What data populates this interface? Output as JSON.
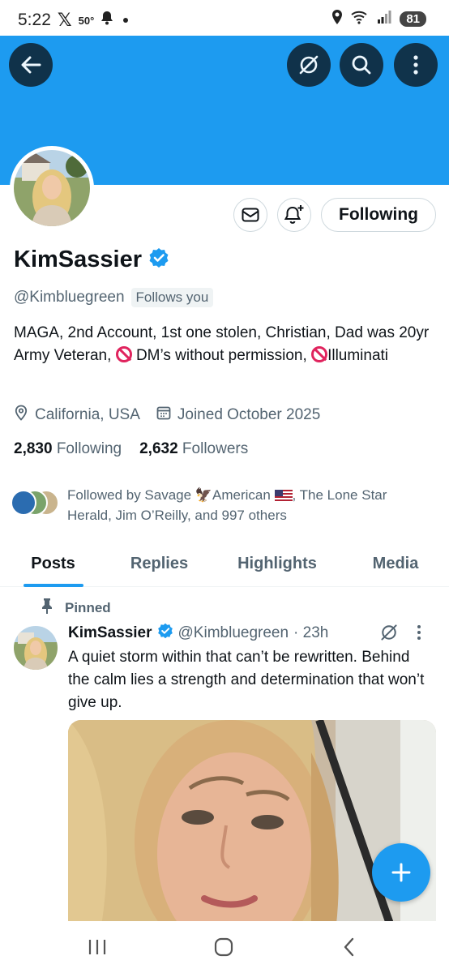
{
  "status_bar": {
    "time": "5:22",
    "temperature": "50°",
    "battery": "81",
    "signal_badge": "6"
  },
  "profile": {
    "display_name": "KimSassier",
    "handle": "@Kimbluegreen",
    "follows_you": "Follows you",
    "bio_part1": "MAGA, 2nd Account, 1st one stolen, Christian, Dad was 20yr Army Veteran, ",
    "bio_part2": " DM’s without permission, ",
    "bio_part3": "Illuminati",
    "location": "California, USA",
    "joined": "Joined October 2025",
    "following_count": "2,830",
    "following_label": "Following",
    "followers_count": "2,632",
    "followers_label": "Followers",
    "followed_by_prefix": "Followed by Savage ",
    "followed_by_mid": "American ",
    "followed_by_rest": ", The Lone Star Herald, Jim O’Reilly, and 997 others"
  },
  "actions": {
    "following_button": "Following"
  },
  "tabs": [
    {
      "label": "Posts",
      "active": true
    },
    {
      "label": "Replies",
      "active": false
    },
    {
      "label": "Highlights",
      "active": false
    },
    {
      "label": "Media",
      "active": false
    }
  ],
  "pinned_post": {
    "pinned_label": "Pinned",
    "author_name": "KimSassier",
    "author_handle": "@Kimbluegreen",
    "time": "· 23h",
    "text": "A quiet storm within that can’t be rewritten. Behind the calm lies a strength and determination that won’t give up."
  },
  "icons": {
    "back": "arrow-left-icon",
    "grok": "grok-icon",
    "search": "search-icon",
    "more": "more-vertical-icon",
    "message": "envelope-icon",
    "notify": "bell-plus-icon",
    "location": "location-pin-icon",
    "calendar": "calendar-icon",
    "verified": "verified-badge-icon",
    "pin": "pin-icon",
    "compose": "plus-icon"
  },
  "colors": {
    "accent": "#1d9bf0",
    "banner": "#1d9bf0",
    "text_primary": "#0f1419",
    "text_secondary": "#536471"
  }
}
